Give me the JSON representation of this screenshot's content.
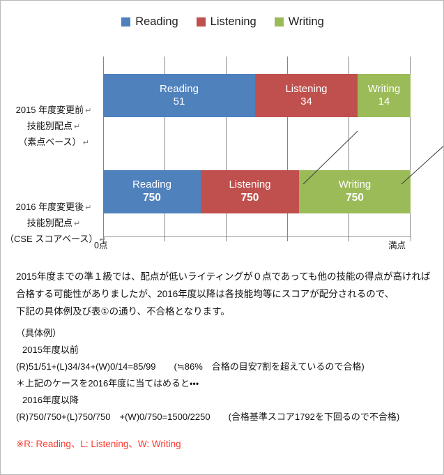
{
  "legend": {
    "items": [
      {
        "label": "Reading",
        "color": "#4F81BD",
        "icon": "square-swatch-icon"
      },
      {
        "label": "Listening",
        "color": "#C0504D",
        "icon": "square-swatch-icon"
      },
      {
        "label": "Writing",
        "color": "#9BBB59",
        "icon": "square-swatch-icon"
      }
    ]
  },
  "categories": {
    "row_2015": {
      "line1": "2015 年度変更前",
      "line2": "技能別配点",
      "line3": "（素点ベース）",
      "mark": "↵"
    },
    "row_2016": {
      "line1": "2016 年度変更後",
      "line2": "技能別配点",
      "line3": "（CSE スコアベース）",
      "mark": "↵"
    }
  },
  "axis": {
    "left_label": "0点",
    "right_label": "満点",
    "tick_count": 6
  },
  "chart_data": {
    "type": "bar",
    "orientation": "horizontal",
    "stacked": true,
    "title": "",
    "xlabel": "",
    "ylabel": "",
    "grid": true,
    "legend_position": "top",
    "categories": [
      "2015 年度変更前 技能別配点（素点ベース）",
      "2016 年度変更後 技能別配点（CSE スコアベース）"
    ],
    "series": [
      {
        "name": "Reading",
        "color": "#4F81BD",
        "values": [
          51,
          750
        ]
      },
      {
        "name": "Listening",
        "color": "#C0504D",
        "values": [
          34,
          750
        ]
      },
      {
        "name": "Writing",
        "color": "#9BBB59",
        "values": [
          14,
          750
        ]
      }
    ],
    "row_totals": [
      99,
      2250
    ],
    "axis_range_labels": [
      "0点",
      "満点"
    ],
    "annotations": [
      "Connector lines link the segment boundaries of the 2015 bar to the 2016 bar"
    ]
  },
  "bars": {
    "row_2015": {
      "segments": [
        {
          "name": "Reading",
          "value": "51",
          "color": "#4F81BD",
          "bold": false
        },
        {
          "name": "Listening",
          "value": "34",
          "color": "#C0504D",
          "bold": false
        },
        {
          "name": "Writing",
          "value": "14",
          "color": "#9BBB59",
          "bold": false
        }
      ]
    },
    "row_2016": {
      "segments": [
        {
          "name": "Reading",
          "value": "750",
          "color": "#4F81BD",
          "bold": true
        },
        {
          "name": "Listening",
          "value": "750",
          "color": "#C0504D",
          "bold": true
        },
        {
          "name": "Writing",
          "value": "750",
          "color": "#9BBB59",
          "bold": true
        }
      ]
    }
  },
  "body": {
    "paragraph_lines": [
      "2015年度までの準１級では、配点が低いライティングが０点であっても他の技能の得点が高ければ",
      "合格する可能性がありましたが、2016年度以降は各技能均等にスコアが配分されるので、",
      "下記の具体例及び表①の通り、不合格となります。"
    ],
    "example_lines": [
      "（具体例）",
      "2015年度以前",
      "(R)51/51+(L)34/34+(W)0/14=85/99　　(≒86%　合格の目安7割を超えているので合格)",
      "＊上記のケースを2016年度に当てはめると・・・",
      "2016年度以降",
      "(R)750/750+(L)750/750　+(W)0/750=1500/2250　　(合格基準スコア1792を下回るので不合格)"
    ],
    "footnote": "※R: Reading、L: Listening、W: Writing"
  }
}
